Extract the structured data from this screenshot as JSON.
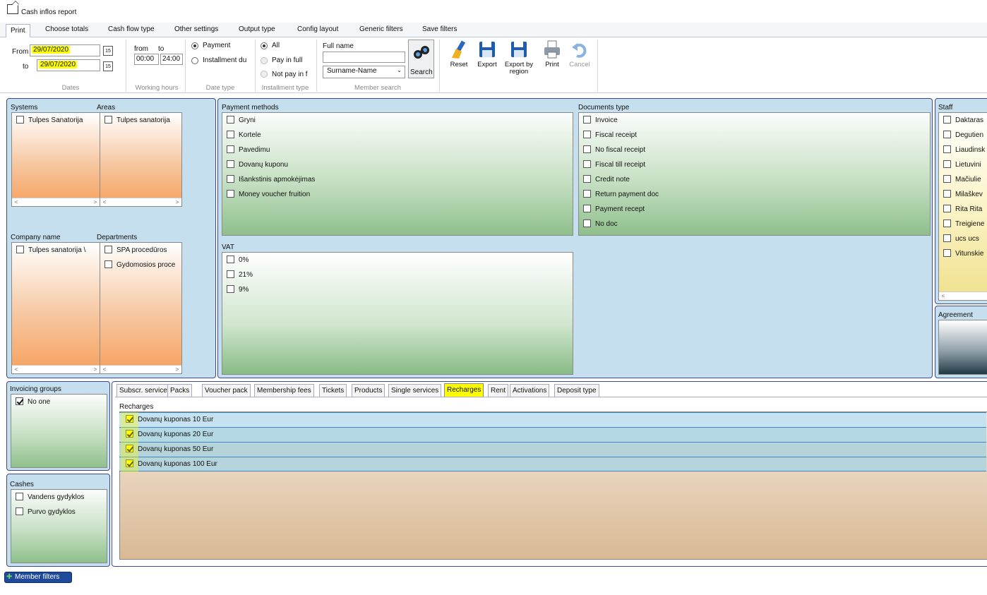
{
  "window": {
    "title": "Cash inflos report"
  },
  "tabs": [
    "Print",
    "Choose totals",
    "Cash flow type",
    "Other settings",
    "Output type",
    "Config layout",
    "Generic filters",
    "Save filters"
  ],
  "dates": {
    "from_label": "From",
    "to_label": "to",
    "from_value": "29/07/2020",
    "to_value": "29/07/2020",
    "caption": "Dates"
  },
  "working_hours": {
    "from_label": "from",
    "to_label": "to",
    "from_value": "00:00",
    "to_value": "24:00",
    "caption": "Working hours"
  },
  "date_type": {
    "options": [
      "Payment",
      "Installment du"
    ],
    "selected": "Payment",
    "caption": "Date type"
  },
  "installment_type": {
    "options": [
      "All",
      "Pay in full",
      "Not pay in f"
    ],
    "selected": "All",
    "caption": "Installment type"
  },
  "member_search": {
    "full_name_label": "Full name",
    "full_name_value": "",
    "order_value": "Surname-Name",
    "search_label": "Search",
    "caption": "Member search"
  },
  "actions": {
    "reset": "Reset",
    "export": "Export",
    "export_region": "Export by region",
    "print": "Print",
    "cancel": "Cancel"
  },
  "systems": {
    "label": "Systems",
    "items": [
      "Tulpes Sanatorija"
    ]
  },
  "areas": {
    "label": "Areas",
    "items": [
      "Tulpes sanatorija"
    ]
  },
  "company": {
    "label": "Company name",
    "items": [
      "Tulpes sanatorija \\"
    ]
  },
  "departments": {
    "label": "Departments",
    "items": [
      "SPA procedūros",
      "Gydomosios proce"
    ]
  },
  "payment_methods": {
    "label": "Payment methods",
    "items": [
      "Gryni",
      "Kortele",
      "Pavedimu",
      "Dovanų kuponu",
      "Išankstinis apmokėjimas",
      "Money voucher fruition"
    ]
  },
  "documents_type": {
    "label": "Documents type",
    "items": [
      "Invoice",
      "Fiscal receipt",
      "No fiscal receipt",
      "Fiscal till receipt",
      "Credit note",
      "Return payment doc",
      "Payment recept",
      "No doc"
    ]
  },
  "vat": {
    "label": "VAT",
    "items": [
      "0%",
      "21%",
      "9%"
    ]
  },
  "staff": {
    "label": "Staff",
    "items": [
      "Daktaras",
      "Degutien",
      "Liaudinsk",
      "Lietuvini",
      "Mačiulie",
      "Milaškev",
      "Rita Rita",
      "Treigiene",
      "ucs ucs",
      "Vitunskie"
    ]
  },
  "agreement": {
    "label": "Agreement"
  },
  "invoicing_groups": {
    "label": "Invoicing groups",
    "items": [
      {
        "text": "No one",
        "checked": true
      }
    ]
  },
  "cashes": {
    "label": "Cashes",
    "items": [
      "Vandens gydyklos",
      "Purvo gydyklos"
    ]
  },
  "bottom_tabs": [
    "Subscr. services",
    "Packs",
    "Voucher pack",
    "Membership fees",
    "Tickets",
    "Products",
    "Single services",
    "Recharges",
    "Rent",
    "Activations",
    "Deposit type"
  ],
  "recharges": {
    "label": "Recharges",
    "items": [
      "Dovanų kuponas 10 Eur",
      "Dovanų kuponas 20 Eur",
      "Dovanų kuponas 50 Eur",
      "Dovanų kuponas 100 Eur"
    ]
  },
  "member_filters": "Member filters",
  "colors": {
    "highlight": "#ffff00",
    "panel_border": "#3c4a8c",
    "panel_bg": "#c5dfee"
  }
}
